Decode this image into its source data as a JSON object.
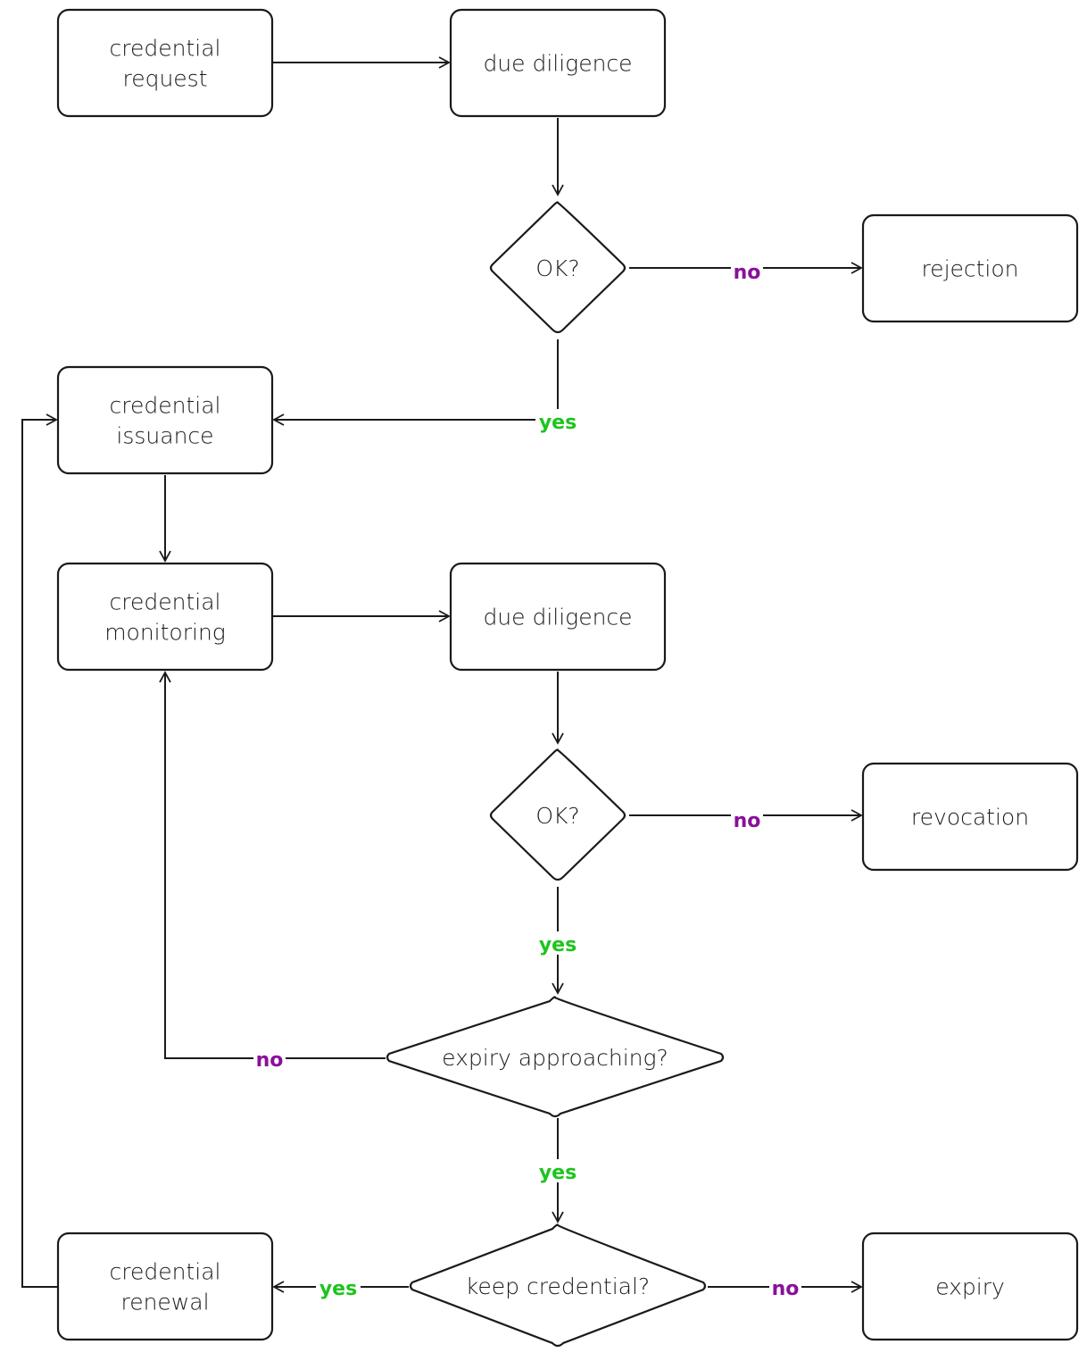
{
  "colors": {
    "yes": "#1ec41e",
    "no": "#8a0f9a",
    "stroke": "#1a1a1a"
  },
  "nodes": [
    {
      "id": "request",
      "shape": "box",
      "lines": [
        "credential",
        "request"
      ]
    },
    {
      "id": "dd1",
      "shape": "box",
      "lines": [
        "due diligence"
      ]
    },
    {
      "id": "ok1",
      "shape": "diamond",
      "lines": [
        "OK?"
      ]
    },
    {
      "id": "rejection",
      "shape": "box",
      "lines": [
        "rejection"
      ]
    },
    {
      "id": "issuance",
      "shape": "box",
      "lines": [
        "credential",
        "issuance"
      ]
    },
    {
      "id": "monitoring",
      "shape": "box",
      "lines": [
        "credential",
        "monitoring"
      ]
    },
    {
      "id": "dd2",
      "shape": "box",
      "lines": [
        "due diligence"
      ]
    },
    {
      "id": "ok2",
      "shape": "diamond",
      "lines": [
        "OK?"
      ]
    },
    {
      "id": "revocation",
      "shape": "box",
      "lines": [
        "revocation"
      ]
    },
    {
      "id": "expiry_q",
      "shape": "diamond",
      "lines": [
        "expiry approaching?"
      ]
    },
    {
      "id": "keep_q",
      "shape": "diamond",
      "lines": [
        "keep credential?"
      ]
    },
    {
      "id": "renewal",
      "shape": "box",
      "lines": [
        "credential",
        "renewal"
      ]
    },
    {
      "id": "expiry",
      "shape": "box",
      "lines": [
        "expiry"
      ]
    }
  ],
  "edges": [
    {
      "from": "request",
      "to": "dd1",
      "label": ""
    },
    {
      "from": "dd1",
      "to": "ok1",
      "label": ""
    },
    {
      "from": "ok1",
      "to": "rejection",
      "label": "no"
    },
    {
      "from": "ok1",
      "to": "issuance",
      "label": "yes"
    },
    {
      "from": "issuance",
      "to": "monitoring",
      "label": ""
    },
    {
      "from": "monitoring",
      "to": "dd2",
      "label": ""
    },
    {
      "from": "dd2",
      "to": "ok2",
      "label": ""
    },
    {
      "from": "ok2",
      "to": "revocation",
      "label": "no"
    },
    {
      "from": "ok2",
      "to": "expiry_q",
      "label": "yes"
    },
    {
      "from": "expiry_q",
      "to": "monitoring",
      "label": "no"
    },
    {
      "from": "expiry_q",
      "to": "keep_q",
      "label": "yes"
    },
    {
      "from": "keep_q",
      "to": "renewal",
      "label": "yes"
    },
    {
      "from": "keep_q",
      "to": "expiry",
      "label": "no"
    },
    {
      "from": "renewal",
      "to": "issuance",
      "label": ""
    }
  ]
}
